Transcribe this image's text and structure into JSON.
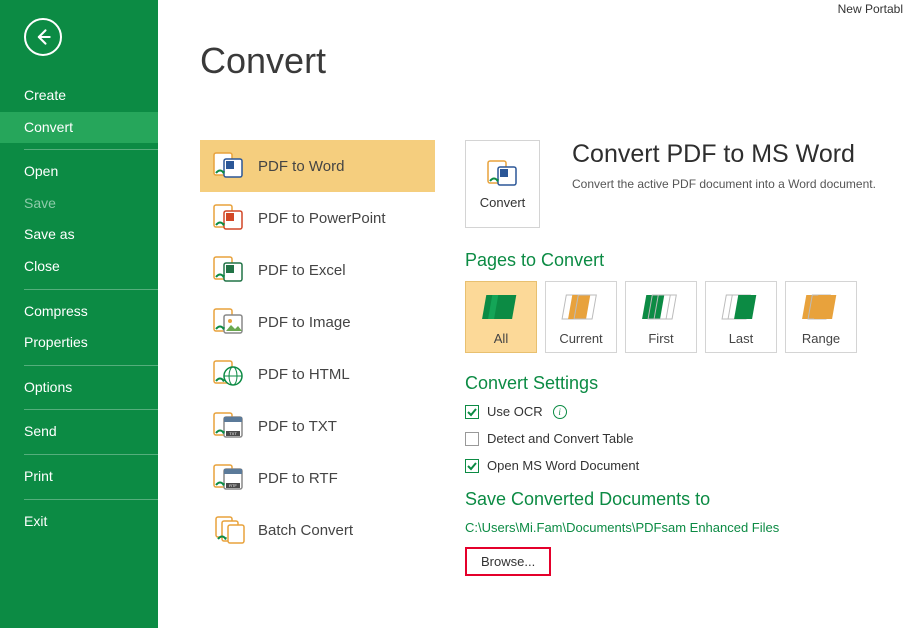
{
  "window_title": "New Portabl",
  "sidebar": {
    "items": [
      {
        "label": "Create"
      },
      {
        "label": "Convert",
        "selected": true
      },
      {
        "label": "Open"
      },
      {
        "label": "Save",
        "disabled": true
      },
      {
        "label": "Save as"
      },
      {
        "label": "Close"
      },
      {
        "label": "Compress"
      },
      {
        "label": "Properties"
      },
      {
        "label": "Options"
      },
      {
        "label": "Send"
      },
      {
        "label": "Print"
      },
      {
        "label": "Exit"
      }
    ]
  },
  "page_title": "Convert",
  "convert_list": [
    {
      "label": "PDF to Word",
      "selected": true,
      "icon": "word"
    },
    {
      "label": "PDF to PowerPoint",
      "icon": "ppt"
    },
    {
      "label": "PDF to Excel",
      "icon": "excel"
    },
    {
      "label": "PDF to Image",
      "icon": "image"
    },
    {
      "label": "PDF to HTML",
      "icon": "html"
    },
    {
      "label": "PDF to TXT",
      "icon": "txt"
    },
    {
      "label": "PDF to RTF",
      "icon": "rtf"
    },
    {
      "label": "Batch Convert",
      "icon": "batch"
    }
  ],
  "detail": {
    "convert_btn": "Convert",
    "title": "Convert PDF to MS Word",
    "desc": "Convert the active PDF document into a Word document.",
    "pages_heading": "Pages to Convert",
    "page_options": [
      {
        "label": "All",
        "selected": true,
        "color": "green"
      },
      {
        "label": "Current",
        "color": "orange"
      },
      {
        "label": "First",
        "color": "green"
      },
      {
        "label": "Last",
        "color": "green"
      },
      {
        "label": "Range",
        "color": "orange"
      }
    ],
    "settings_heading": "Convert Settings",
    "checkboxes": [
      {
        "label": "Use OCR",
        "checked": true,
        "info": true
      },
      {
        "label": "Detect and Convert Table",
        "checked": false
      },
      {
        "label": "Open MS Word Document",
        "checked": true
      }
    ],
    "save_heading": "Save Converted Documents to",
    "save_path": "C:\\Users\\Mi.Fam\\Documents\\PDFsam Enhanced Files",
    "browse_label": "Browse..."
  }
}
